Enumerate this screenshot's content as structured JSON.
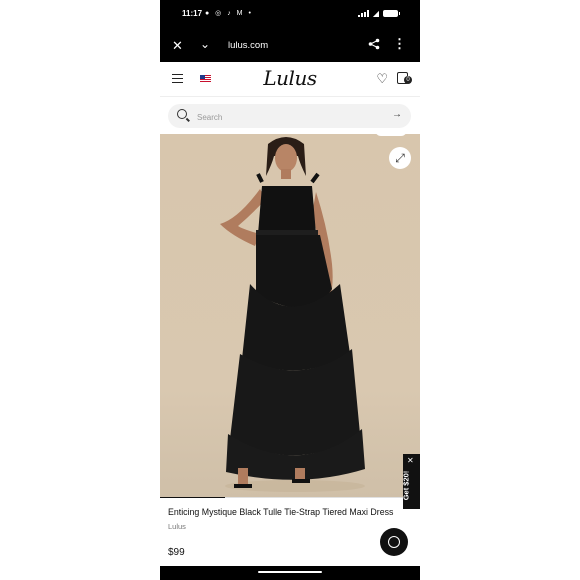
{
  "status_bar": {
    "time": "11:17",
    "notification_icons": "● ◎ ♪ M •"
  },
  "browser": {
    "url": "lulus.com",
    "close_glyph": "✕",
    "chevron_glyph": "⌄",
    "more_glyph": "⋮"
  },
  "site_nav": {
    "logo": "Lulus",
    "heart_glyph": "♡",
    "cart_count": "0"
  },
  "search": {
    "placeholder": "Search",
    "arrow_glyph": "→"
  },
  "product": {
    "title": "Enticing Mystique Black Tulle Tie-Strap Tiered Maxi Dress",
    "brand": "Lulus",
    "price": "$99",
    "image_progress": 0.25
  },
  "promo": {
    "label": "Get $20!",
    "close_glyph": "✕"
  },
  "icons": [
    "close-icon",
    "chevron-down-icon",
    "share-icon",
    "more-icon",
    "menu-icon",
    "flag-icon",
    "heart-icon",
    "bag-icon",
    "search-icon",
    "arrow-right-icon",
    "expand-icon",
    "chat-icon"
  ],
  "colors": {
    "background": "#ffffff",
    "bars": "#000000",
    "photo_backdrop": "#d8c6ad",
    "dress": "#111111"
  }
}
